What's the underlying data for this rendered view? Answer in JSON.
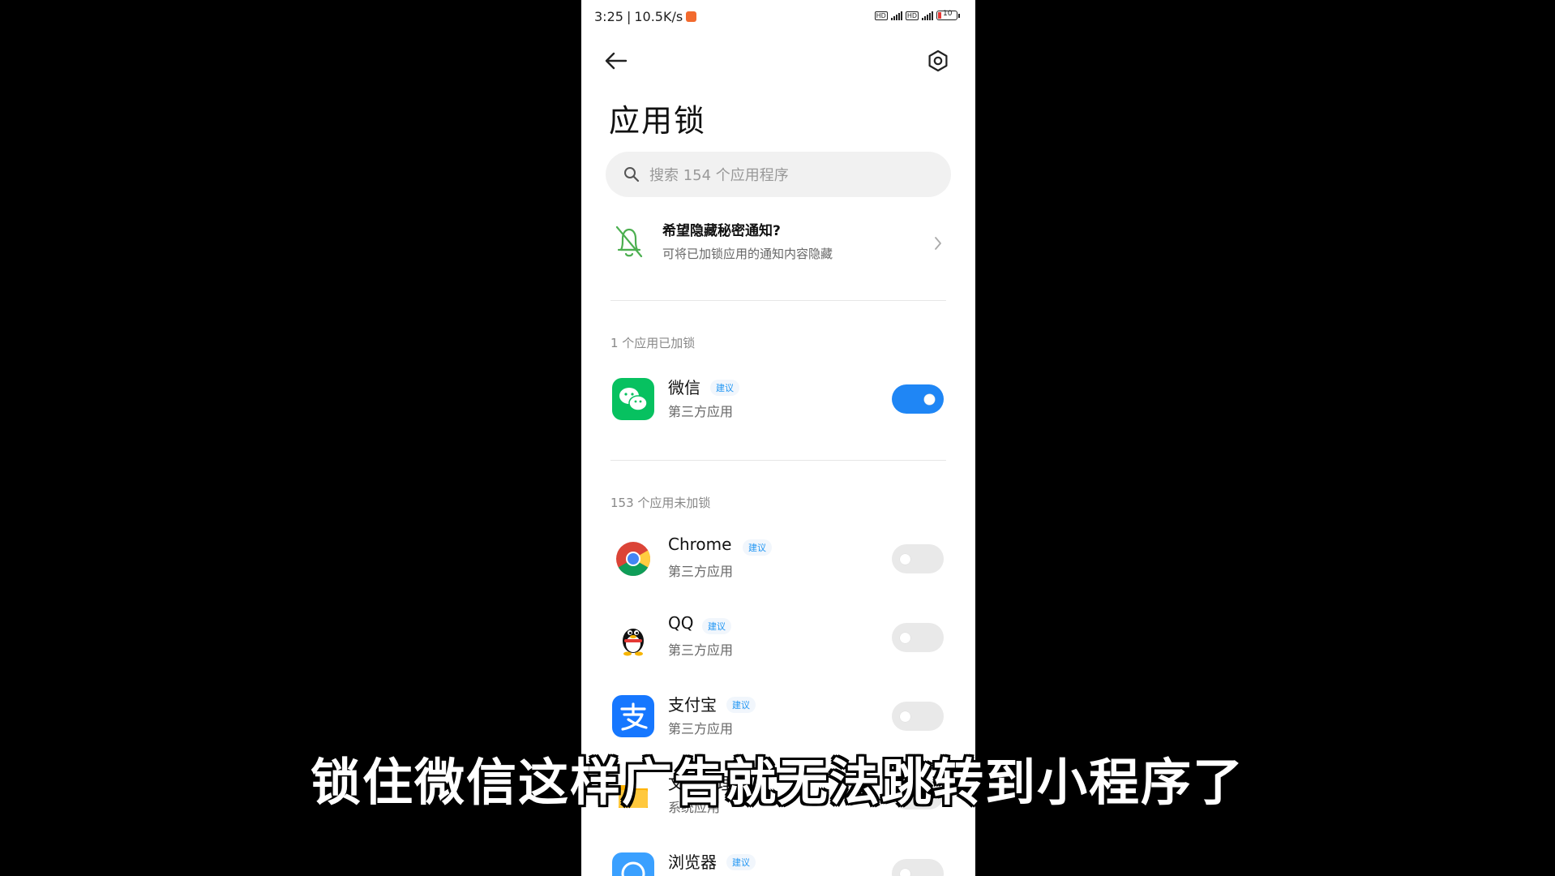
{
  "status": {
    "time": "3:25",
    "speed": "10.5K/s",
    "battery": "10"
  },
  "header": {
    "title": "应用锁"
  },
  "search": {
    "placeholder": "搜索 154 个应用程序"
  },
  "notice": {
    "title": "希望隐藏秘密通知?",
    "subtitle": "可将已加锁应用的通知内容隐藏"
  },
  "locked_section": {
    "label": "1 个应用已加锁",
    "apps": [
      {
        "name": "微信",
        "tag": "建议",
        "type": "第三方应用",
        "locked": true
      }
    ]
  },
  "unlocked_section": {
    "label": "153 个应用未加锁",
    "apps": [
      {
        "name": "Chrome",
        "tag": "建议",
        "type": "第三方应用",
        "locked": false
      },
      {
        "name": "QQ",
        "tag": "建议",
        "type": "第三方应用",
        "locked": false
      },
      {
        "name": "支付宝",
        "tag": "建议",
        "type": "第三方应用",
        "locked": false
      },
      {
        "name": "文件管理",
        "tag": "",
        "type": "系统应用",
        "locked": false
      },
      {
        "name": "浏览器",
        "tag": "建议",
        "type": "",
        "locked": false
      }
    ]
  },
  "caption": "锁住微信这样广告就无法跳转到小程序了",
  "colors": {
    "toggle_on": "#1f86f5",
    "wechat": "#07c160",
    "alipay": "#1677ff",
    "tag": "#2196f3"
  }
}
